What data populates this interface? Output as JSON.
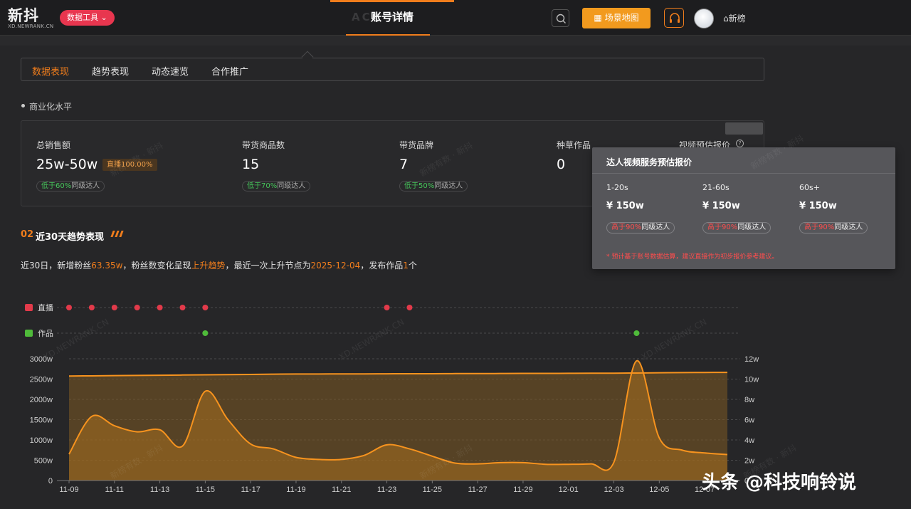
{
  "header": {
    "logo": "新抖",
    "logo_sub": "XD.NEWRANK.CN",
    "tools_label": "数据工具",
    "page_title": "账号详情",
    "ghost_text": "ACC     NT",
    "scene_label": "场景地图",
    "ranking_label": "新榜"
  },
  "tabs": [
    {
      "label": "数据表现",
      "active": true
    },
    {
      "label": "趋势表现"
    },
    {
      "label": "动态速览"
    },
    {
      "label": "合作推广"
    }
  ],
  "commercial": {
    "section_label": "商业化水平",
    "metrics": [
      {
        "label": "总销售额",
        "value": "25w-50w",
        "tag": "直播100.00%",
        "badge_pct": "低于60%",
        "badge_text": "同级达人"
      },
      {
        "label": "带货商品数",
        "value": "15",
        "badge_pct": "低于70%",
        "badge_text": "同级达人"
      },
      {
        "label": "带货品牌",
        "value": "7",
        "badge_pct": "低于50%",
        "badge_text": "同级达人"
      },
      {
        "label": "种草作品",
        "value": "0"
      },
      {
        "label": "视频预估报价"
      }
    ]
  },
  "popover": {
    "title": "达人视频服务预估报价",
    "cols": [
      {
        "range": "1-20s",
        "price": "¥ 150w",
        "pct": "高于90%",
        "text": "同级达人"
      },
      {
        "range": "21-60s",
        "price": "¥ 150w",
        "pct": "高于90%",
        "text": "同级达人"
      },
      {
        "range": "60s+",
        "price": "¥ 150w",
        "pct": "高于90%",
        "text": "同级达人"
      }
    ],
    "note": "* 预计基于账号数据估算，建议直接作为初步报价参考建议。"
  },
  "trend": {
    "section_no": "02",
    "section_title": "近30天趋势表现",
    "summary": {
      "p1": "近30日，新增粉丝",
      "fans": "63.35w",
      "p2": "，粉丝数变化呈现",
      "trend": "上升趋势",
      "p3": "，最近一次上升节点为",
      "date": "2025-12-04",
      "p4": "，发布作品",
      "works": "1",
      "p5": "个"
    }
  },
  "chart_data": {
    "type": "area",
    "x": [
      "11-09",
      "11-10",
      "11-11",
      "11-12",
      "11-13",
      "11-14",
      "11-15",
      "11-16",
      "11-17",
      "11-18",
      "11-19",
      "11-20",
      "11-21",
      "11-22",
      "11-23",
      "11-24",
      "11-25",
      "11-26",
      "11-27",
      "11-28",
      "11-29",
      "11-30",
      "12-01",
      "12-02",
      "12-03",
      "12-04",
      "12-05",
      "12-06",
      "12-07",
      "12-08"
    ],
    "x_ticks": [
      "11-09",
      "11-11",
      "11-13",
      "11-15",
      "11-17",
      "11-19",
      "11-21",
      "11-23",
      "11-25",
      "11-27",
      "11-29",
      "12-01",
      "12-03",
      "12-05",
      "12-07"
    ],
    "y_left_ticks": [
      "0",
      "500w",
      "1000w",
      "1500w",
      "2000w",
      "2500w",
      "3000w"
    ],
    "ylim_left": [
      0,
      3000
    ],
    "y_right_ticks": [
      "0",
      "2w",
      "4w",
      "6w",
      "8w",
      "10w",
      "12w"
    ],
    "ylim_right": [
      0,
      12
    ],
    "series": [
      {
        "axis": "left",
        "values": [
          650,
          1580,
          1350,
          1200,
          1250,
          850,
          2200,
          1500,
          900,
          780,
          570,
          520,
          520,
          620,
          880,
          780,
          600,
          430,
          410,
          440,
          440,
          400,
          400,
          410,
          450,
          2950,
          1050,
          750,
          680,
          640
        ]
      },
      {
        "axis": "right",
        "values": [
          10.3,
          10.32,
          10.34,
          10.36,
          10.38,
          10.4,
          10.42,
          10.44,
          10.46,
          10.48,
          10.5,
          10.5,
          10.51,
          10.51,
          10.52,
          10.53,
          10.53,
          10.54,
          10.54,
          10.55,
          10.56,
          10.56,
          10.57,
          10.58,
          10.58,
          10.6,
          10.62,
          10.64,
          10.65,
          10.66
        ]
      }
    ],
    "events": [
      {
        "label": "直播",
        "color": "#e23a4a",
        "dates": [
          "11-09",
          "11-10",
          "11-11",
          "11-12",
          "11-13",
          "11-14",
          "11-15",
          "11-23",
          "11-24"
        ]
      },
      {
        "label": "作品",
        "color": "#4fbb3a",
        "dates": [
          "11-15",
          "12-04"
        ]
      }
    ],
    "colors": {
      "line": "#f7931e",
      "area": "#7d5a22"
    }
  },
  "watermarks": [
    "新榜有数 · 新抖",
    "XD.NEWRANK.CN"
  ],
  "footer_watermark": "头条 @科技响铃说"
}
